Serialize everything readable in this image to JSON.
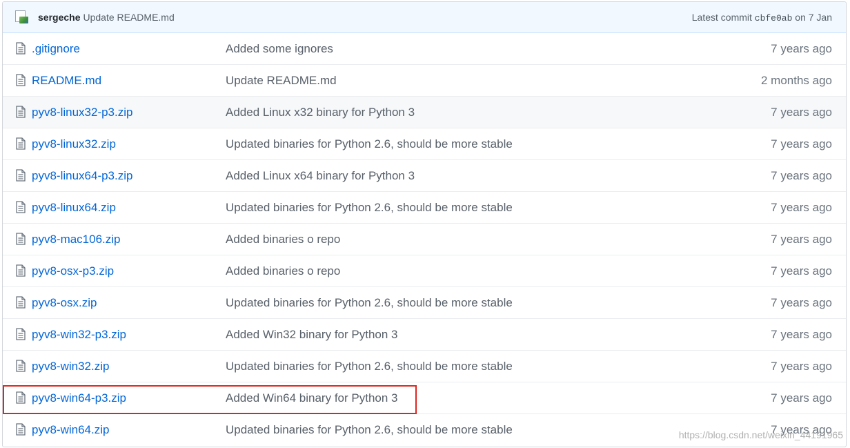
{
  "header": {
    "author": "sergeche",
    "message": "Update README.md",
    "latest_prefix": "Latest commit",
    "sha": "cbfe0ab",
    "date": "on 7 Jan"
  },
  "files": [
    {
      "name": ".gitignore",
      "message": "Added some ignores",
      "age": "7 years ago"
    },
    {
      "name": "README.md",
      "message": "Update README.md",
      "age": "2 months ago"
    },
    {
      "name": "pyv8-linux32-p3.zip",
      "message": "Added Linux x32 binary for Python 3",
      "age": "7 years ago"
    },
    {
      "name": "pyv8-linux32.zip",
      "message": "Updated binaries for Python 2.6, should be more stable",
      "age": "7 years ago"
    },
    {
      "name": "pyv8-linux64-p3.zip",
      "message": "Added Linux x64 binary for Python 3",
      "age": "7 years ago"
    },
    {
      "name": "pyv8-linux64.zip",
      "message": "Updated binaries for Python 2.6, should be more stable",
      "age": "7 years ago"
    },
    {
      "name": "pyv8-mac106.zip",
      "message": "Added binaries o repo",
      "age": "7 years ago"
    },
    {
      "name": "pyv8-osx-p3.zip",
      "message": "Added binaries o repo",
      "age": "7 years ago"
    },
    {
      "name": "pyv8-osx.zip",
      "message": "Updated binaries for Python 2.6, should be more stable",
      "age": "7 years ago"
    },
    {
      "name": "pyv8-win32-p3.zip",
      "message": "Added Win32 binary for Python 3",
      "age": "7 years ago"
    },
    {
      "name": "pyv8-win32.zip",
      "message": "Updated binaries for Python 2.6, should be more stable",
      "age": "7 years ago"
    },
    {
      "name": "pyv8-win64-p3.zip",
      "message": "Added Win64 binary for Python 3",
      "age": "7 years ago"
    },
    {
      "name": "pyv8-win64.zip",
      "message": "Updated binaries for Python 2.6, should be more stable",
      "age": "7 years ago"
    }
  ],
  "icons": {
    "file": "file-icon",
    "avatar": "avatar-image"
  },
  "colors": {
    "link": "#0366d6",
    "highlight": "#e0251f",
    "header_bg": "#f1f8ff"
  },
  "watermark": "https://blog.csdn.net/weixin_44191965"
}
